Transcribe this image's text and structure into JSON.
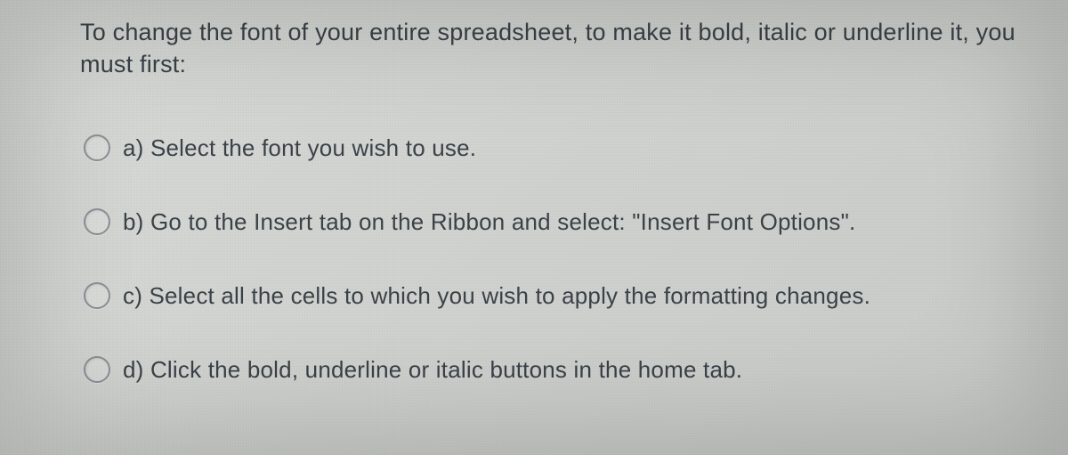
{
  "question": "To change the font of your entire spreadsheet, to make it bold, italic or underline it, you must first:",
  "options": {
    "a": "a) Select the font you wish to use.",
    "b": "b) Go to the Insert tab on the Ribbon and select:  \"Insert Font Options\".",
    "c": "c) Select all the cells to which you wish to apply the formatting changes.",
    "d": "d) Click the bold, underline or italic buttons in the home tab."
  }
}
